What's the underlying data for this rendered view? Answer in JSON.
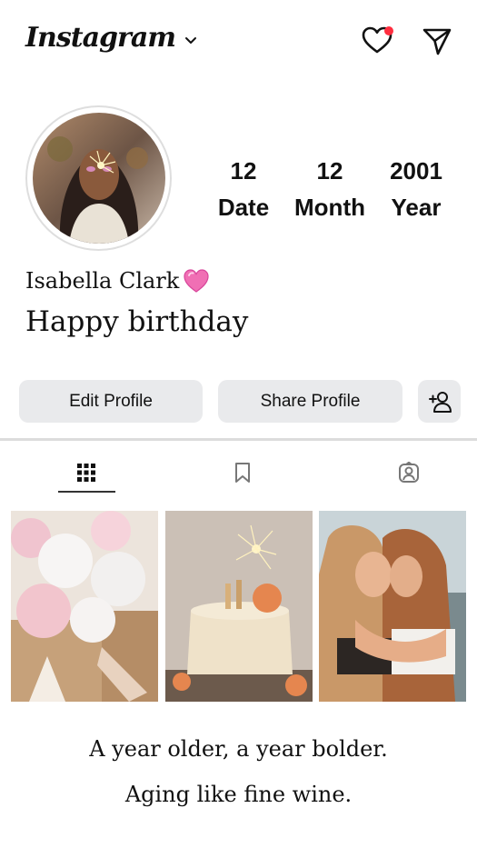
{
  "header": {
    "app_name": "Instagram",
    "icons": [
      "chevron-down-icon",
      "heart-icon",
      "send-icon"
    ],
    "notification_dot_color": "#ff2d3f"
  },
  "profile": {
    "stats": [
      {
        "value": "12",
        "label": "Date"
      },
      {
        "value": "12",
        "label": "Month"
      },
      {
        "value": "2001",
        "label": "Year"
      }
    ],
    "name": "Isabella Clark",
    "name_emoji": "pink-heart-icon",
    "bio": "Happy birthday"
  },
  "actions": {
    "edit_label": "Edit Profile",
    "share_label": "Share Profile",
    "add_icon": "add-person-icon"
  },
  "tabs": [
    {
      "icon": "grid-icon",
      "active": true
    },
    {
      "icon": "bookmark-icon",
      "active": false
    },
    {
      "icon": "tagged-person-icon",
      "active": false
    }
  ],
  "posts": [
    {
      "subject": "balloons"
    },
    {
      "subject": "birthday-cake-sparkler"
    },
    {
      "subject": "two-friends-hugging"
    }
  ],
  "captions": {
    "line1": "A year older, a year bolder.",
    "line2": "Aging like fine wine."
  }
}
